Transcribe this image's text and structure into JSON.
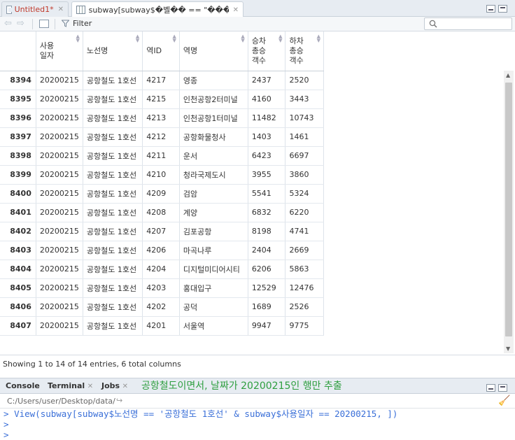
{
  "tabs": [
    {
      "label": "Untitled1*",
      "color": "#c0392b",
      "active": false
    },
    {
      "label": "subway[subway$�벨�� == \"����...",
      "color": "#333333",
      "active": true
    }
  ],
  "toolbar": {
    "filter_label": "Filter",
    "search_placeholder": ""
  },
  "table": {
    "columns": [
      "사용\n일자",
      "노선명",
      "역ID",
      "역명",
      "승차\n총승\n객수",
      "하차\n총승\n객수"
    ],
    "rows": [
      {
        "rn": "8394",
        "date": "20200215",
        "line": "공항철도 1호선",
        "id": "4217",
        "name": "영종",
        "on": "2437",
        "off": "2520"
      },
      {
        "rn": "8395",
        "date": "20200215",
        "line": "공항철도 1호선",
        "id": "4215",
        "name": "인천공항2터미널",
        "on": "4160",
        "off": "3443"
      },
      {
        "rn": "8396",
        "date": "20200215",
        "line": "공항철도 1호선",
        "id": "4213",
        "name": "인천공항1터미널",
        "on": "11482",
        "off": "10743"
      },
      {
        "rn": "8397",
        "date": "20200215",
        "line": "공항철도 1호선",
        "id": "4212",
        "name": "공항화물청사",
        "on": "1403",
        "off": "1461"
      },
      {
        "rn": "8398",
        "date": "20200215",
        "line": "공항철도 1호선",
        "id": "4211",
        "name": "운서",
        "on": "6423",
        "off": "6697"
      },
      {
        "rn": "8399",
        "date": "20200215",
        "line": "공항철도 1호선",
        "id": "4210",
        "name": "청라국제도시",
        "on": "3955",
        "off": "3860"
      },
      {
        "rn": "8400",
        "date": "20200215",
        "line": "공항철도 1호선",
        "id": "4209",
        "name": "검암",
        "on": "5541",
        "off": "5324"
      },
      {
        "rn": "8401",
        "date": "20200215",
        "line": "공항철도 1호선",
        "id": "4208",
        "name": "계양",
        "on": "6832",
        "off": "6220"
      },
      {
        "rn": "8402",
        "date": "20200215",
        "line": "공항철도 1호선",
        "id": "4207",
        "name": "김포공항",
        "on": "8198",
        "off": "4741"
      },
      {
        "rn": "8403",
        "date": "20200215",
        "line": "공항철도 1호선",
        "id": "4206",
        "name": "마곡나루",
        "on": "2404",
        "off": "2669"
      },
      {
        "rn": "8404",
        "date": "20200215",
        "line": "공항철도 1호선",
        "id": "4204",
        "name": "디지털미디어시티",
        "on": "6206",
        "off": "5863"
      },
      {
        "rn": "8405",
        "date": "20200215",
        "line": "공항철도 1호선",
        "id": "4203",
        "name": "홍대입구",
        "on": "12529",
        "off": "12476"
      },
      {
        "rn": "8406",
        "date": "20200215",
        "line": "공항철도 1호선",
        "id": "4202",
        "name": "공덕",
        "on": "1689",
        "off": "2526"
      },
      {
        "rn": "8407",
        "date": "20200215",
        "line": "공항철도 1호선",
        "id": "4201",
        "name": "서울역",
        "on": "9947",
        "off": "9775"
      }
    ]
  },
  "status": {
    "text": "Showing 1 to 14 of 14 entries, 6 total columns"
  },
  "console": {
    "tabs": [
      "Console",
      "Terminal",
      "Jobs"
    ],
    "annotation": "공항철도이면서, 날짜가 20200215인 행만 추출",
    "annotation_color": "#2e9e3f",
    "path": "C:/Users/user/Desktop/data/",
    "lines": [
      "View(subway[subway$노선명 == '공항철도 1호선' & subway$사용일자 == 20200215, ])",
      "",
      ""
    ],
    "prompt": ">"
  }
}
